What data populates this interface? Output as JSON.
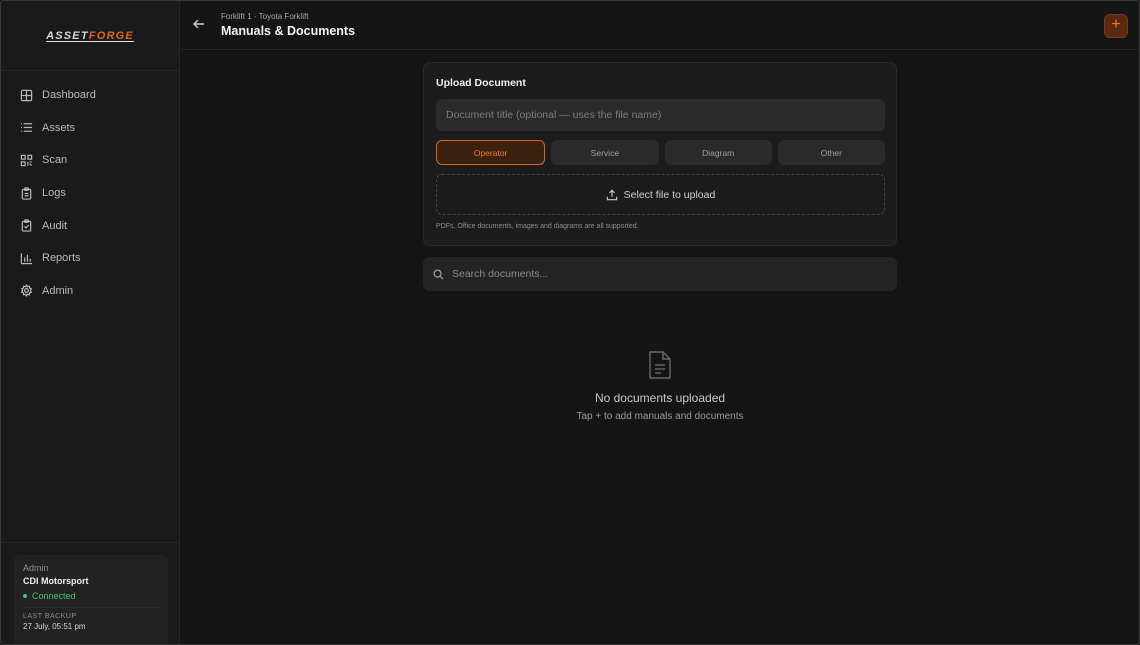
{
  "app": {
    "logo_part1": "ASSET",
    "logo_part2": "FORGE",
    "accent_color": "#e2621a"
  },
  "sidebar": {
    "items": [
      {
        "label": "Dashboard",
        "icon": "grid-icon"
      },
      {
        "label": "Assets",
        "icon": "list-icon"
      },
      {
        "label": "Scan",
        "icon": "qr-icon"
      },
      {
        "label": "Logs",
        "icon": "clipboard-icon"
      },
      {
        "label": "Audit",
        "icon": "clipboard-check-icon"
      },
      {
        "label": "Reports",
        "icon": "bar-chart-icon"
      },
      {
        "label": "Admin",
        "icon": "gear-icon"
      }
    ],
    "account": {
      "role": "Admin",
      "name": "CDI Motorsport",
      "status": "Connected",
      "backup_label": "LAST BACKUP",
      "backup_value": "27 July, 05:51 pm"
    }
  },
  "header": {
    "breadcrumb": "Forklift 1 · Toyota Forklift",
    "title": "Manuals & Documents",
    "add_label": "+"
  },
  "upload": {
    "title": "Upload Document",
    "input_placeholder": "Document title (optional — uses the file name)",
    "types": [
      "Operator",
      "Service",
      "Diagram",
      "Other"
    ],
    "selected_type": "Operator",
    "select_file_label": "Select file to upload",
    "hint": "PDFs, Office documents, images and diagrams are all supported."
  },
  "search": {
    "placeholder": "Search documents..."
  },
  "empty": {
    "title": "No documents uploaded",
    "subtitle": "Tap + to add manuals and documents"
  }
}
